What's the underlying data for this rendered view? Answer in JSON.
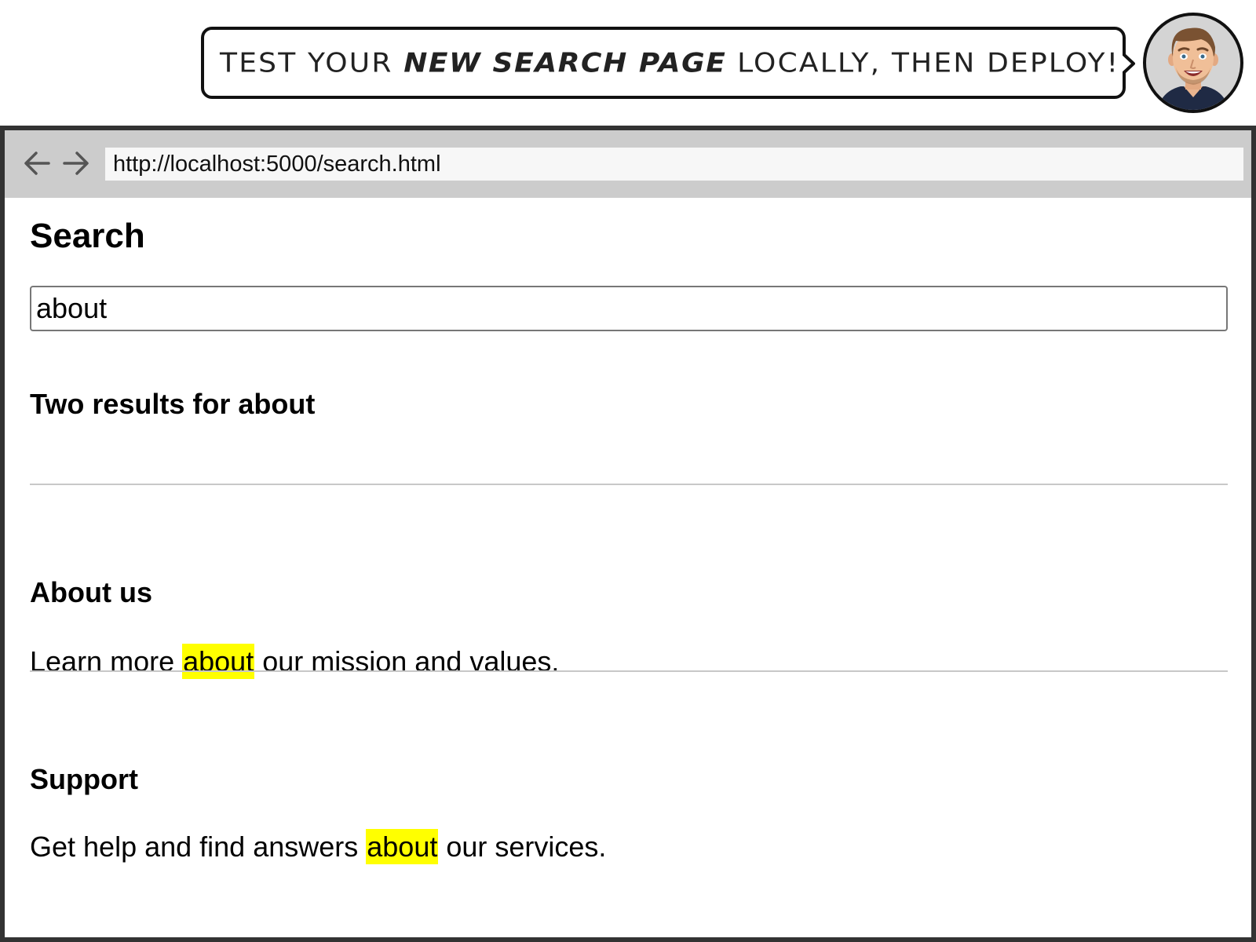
{
  "banner": {
    "text_before": "Test your ",
    "text_emphasis": "new search page",
    "text_after": " locally, then deploy!",
    "avatar_icon": "man-avatar-icon"
  },
  "browser": {
    "url": "http://localhost:5000/search.html",
    "back_icon": "arrow-left-icon",
    "forward_icon": "arrow-right-icon"
  },
  "page": {
    "title": "Search",
    "search_value": "about",
    "results_summary": "Two results for about",
    "highlight_color": "#ffff00",
    "results": [
      {
        "title": "About us",
        "snippet_before": "Learn more ",
        "snippet_match": "about",
        "snippet_after": " our mission and values."
      },
      {
        "title": "Support",
        "snippet_before": "Get help and find answers ",
        "snippet_match": "about",
        "snippet_after": " our services."
      }
    ]
  }
}
